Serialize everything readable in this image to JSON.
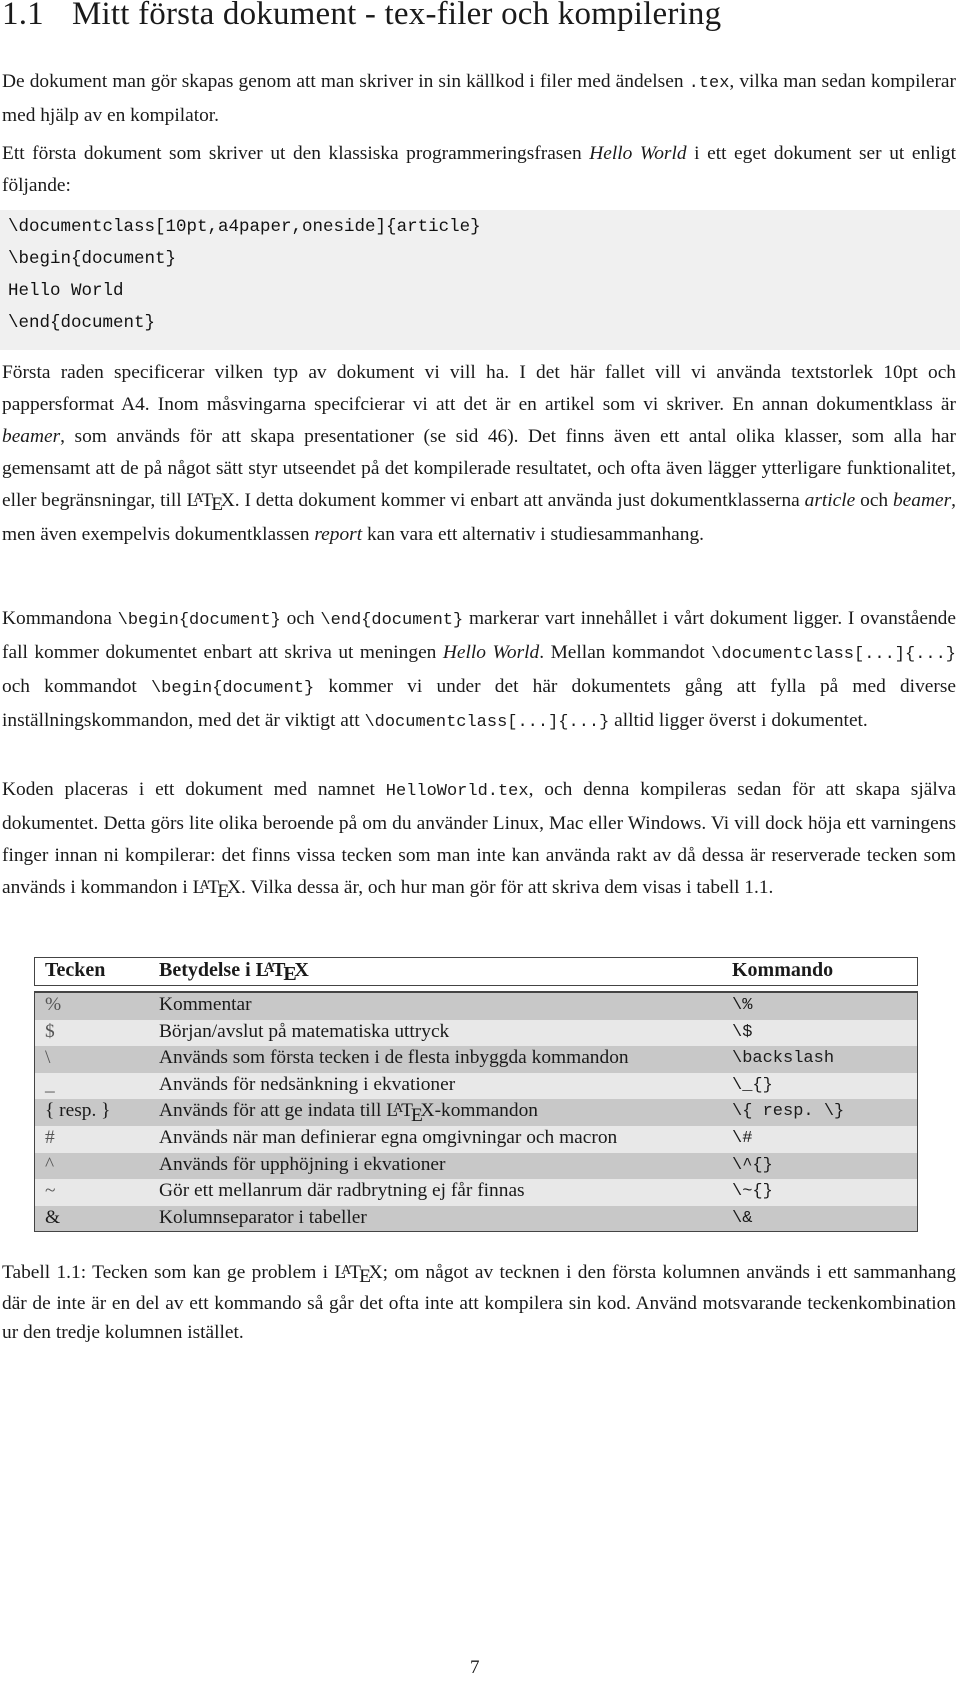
{
  "section": {
    "number": "1.1",
    "title": "Mitt första dokument - tex-filer och kompilering"
  },
  "paragraphs": {
    "p1": {
      "a": "De dokument man gör skapas genom att man skriver in sin källkod i filer med ändelsen ",
      "code": ".tex",
      "b": ", vilka man sedan kompilerar med hjälp av en kompilator."
    },
    "p2": {
      "a": "Ett första dokument som skriver ut den klassiska programmeringsfrasen ",
      "em": "Hello World",
      "b": " i ett eget dokument ser ut enligt följande:"
    },
    "p3": {
      "a": "Första raden specificerar vilken typ av dokument vi vill ha. I det här fallet vill vi använda textstorlek 10pt och pappersformat A4. Inom måsvingarna specifcierar vi att det är en artikel som vi skriver. En annan dokumentklass är ",
      "em1": "beamer",
      "b": ", som används för att skapa presentationer (se sid 46). Det finns även ett antal olika klasser, som alla har gemensamt att de på något sätt styr utseendet på det kompilerade resultatet, och ofta även lägger ytterligare funktionalitet, eller begränsningar, till ",
      "c": ". I detta dokument kommer vi enbart att använda just dokumentklasserna ",
      "em2": "article",
      "d": " och ",
      "em3": "beamer",
      "e": ", men även exempelvis dokumentklassen ",
      "em4": "report",
      "f": " kan vara ett alternativ i studiesammanhang."
    },
    "p4": {
      "a": "Kommandona ",
      "code1": "\\begin{document}",
      "b": " och ",
      "code2": "\\end{document}",
      "c": " markerar vart innehållet i vårt dokument ligger. I ovanstående fall kommer dokumentet enbart att skriva ut meningen ",
      "em": "Hello World",
      "d": ". Mellan kommandot ",
      "code3": "\\documentclass[...]{...}",
      "e": " och kommandot ",
      "code4": "\\begin{document}",
      "f": " kommer vi under det här dokumentets gång att fylla på med diverse inställningskommandon, med det är viktigt att ",
      "code5": "\\documentclass[...]{...}",
      "g": " alltid ligger överst i dokumentet."
    },
    "p5": {
      "a": "Koden placeras i ett dokument med namnet ",
      "code": "HelloWorld.tex",
      "b": ", och denna kompileras sedan för att skapa själva dokumentet. Detta görs lite olika beroende på om du använder Linux, Mac eller Windows. Vi vill dock höja ett varningens finger innan ni kompilerar: det finns vissa tecken som man inte kan använda rakt av då dessa är reserverade tecken som används i kommandon i ",
      "c": ". Vilka dessa är, och hur man gör för att skriva dem visas i tabell 1.1."
    }
  },
  "latex_logo": {
    "l": "L",
    "a": "A",
    "t": "T",
    "e": "E",
    "x": "X"
  },
  "code_block": {
    "lines": [
      "\\documentclass[10pt,a4paper,oneside]{article}",
      "\\begin{document}",
      "Hello World",
      "\\end{document}"
    ]
  },
  "table": {
    "headers": {
      "col1": "Tecken",
      "col2_prefix": "Betydelse i ",
      "col3": "Kommando"
    },
    "rows": [
      {
        "char": "%",
        "meaning": "Kommentar",
        "command": "\\%"
      },
      {
        "char": "$",
        "meaning": "Början/avslut på matematiska uttryck",
        "command": "\\$"
      },
      {
        "char": "\\",
        "meaning": "Används som första tecken i de flesta inbyggda kommandon",
        "command": "\\backslash"
      },
      {
        "char": "_",
        "meaning": "Används för nedsänkning i ekvationer",
        "command": "\\_{}"
      },
      {
        "char": "{ resp. }",
        "meaning_prefix": "Används för att ge indata till ",
        "meaning_suffix": "-kommandon",
        "command": "\\{ resp. \\}"
      },
      {
        "char": "#",
        "meaning": "Används när man definierar egna omgivningar och macron",
        "command": "\\#"
      },
      {
        "char": "^",
        "meaning": "Används för upphöjning i ekvationer",
        "command": "\\^{}"
      },
      {
        "char": "~",
        "meaning": "Gör ett mellanrum där radbrytning ej får finnas",
        "command": "\\~{}"
      },
      {
        "char": "&",
        "meaning": "Kolumnseparator i tabeller",
        "command": "\\&"
      }
    ],
    "colors": {
      "row_dark": "#c8c8c8",
      "row_light": "#e8e8e8",
      "border": "#444444"
    }
  },
  "caption": {
    "a": "Tabell 1.1: Tecken som kan ge problem i ",
    "b": "; om något av tecknen i den första kolumnen används i ett sammanhang där de inte är en del av ett kommando så går det ofta inte att kompilera sin kod. Använd motsvarande teckenkombination ur den tredje kolumnen istället."
  },
  "page_number": "7",
  "colors": {
    "code_bg": "#f0f0f0",
    "text": "#1a1a1a"
  }
}
